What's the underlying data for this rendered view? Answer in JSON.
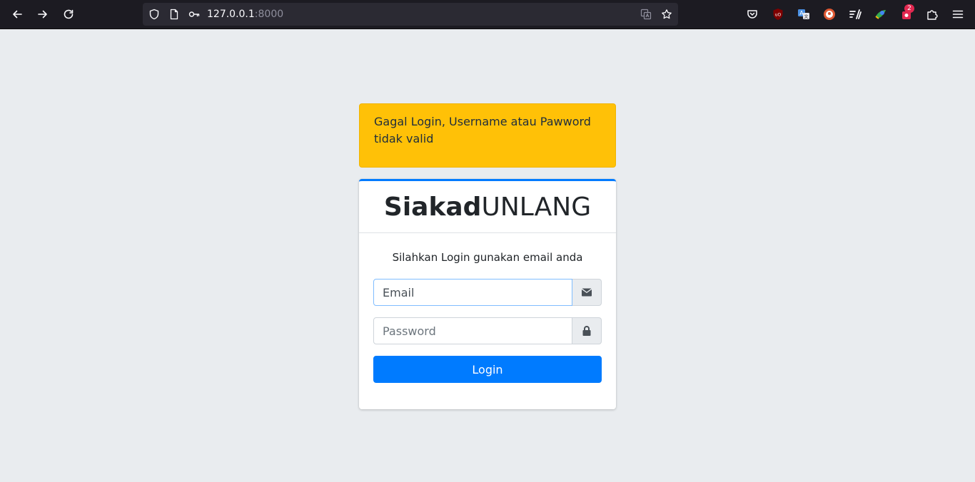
{
  "browser": {
    "url_host": "127.0.0.1",
    "url_port": ":8000",
    "notification_badge": "2"
  },
  "alert": {
    "message": "Gagal Login, Username atau Pawword tidak valid",
    "color": "#ffc107"
  },
  "logo": {
    "bold": "Siakad",
    "regular": "UNLANG"
  },
  "login": {
    "message": "Silahkan Login gunakan email anda",
    "email_placeholder": "Email",
    "password_placeholder": "Password",
    "button_label": "Login",
    "accent_color": "#007bff"
  },
  "icons": {
    "email_addon": "envelope-icon",
    "password_addon": "lock-icon"
  }
}
